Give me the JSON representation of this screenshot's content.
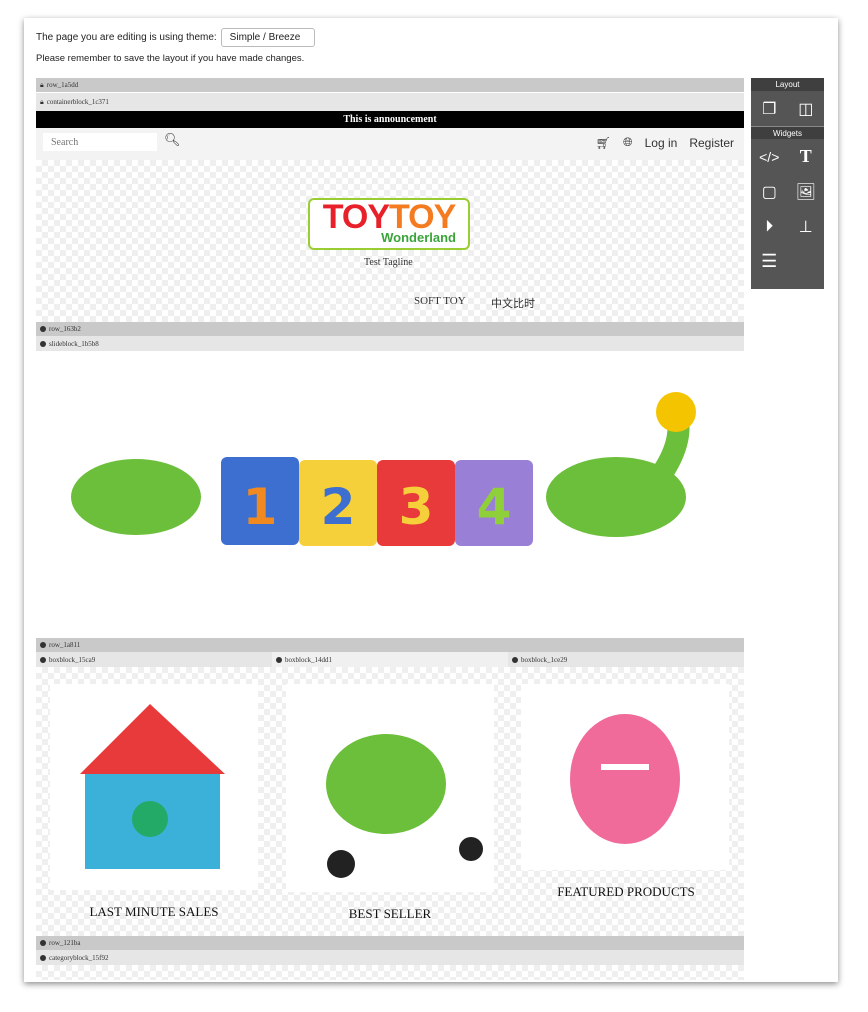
{
  "notice": {
    "theme_label": "The page you are editing is using theme:",
    "theme_value": "Simple / Breeze",
    "reminder": "Please remember to save the layout if you have made changes."
  },
  "blocks": {
    "row1": "row_1a5dd",
    "container": "containerblock_1c371",
    "row2": "row_163b2",
    "slide": "slideblock_1b5b8",
    "row3": "row_1a811",
    "box1": "boxblock_15ca9",
    "box2": "boxblock_14dd1",
    "box3": "boxblock_1ce29",
    "row4": "row_121ba",
    "category": "categoryblock_15f92"
  },
  "announcement": "This is announcement",
  "header": {
    "search_placeholder": "Search",
    "login": "Log in",
    "register": "Register"
  },
  "logo": {
    "text1": "TOY",
    "text2": "TOY",
    "sub": "Wonderland",
    "tagline": "Test Tagline"
  },
  "menu": [
    "SOFT TOY",
    "中文比时"
  ],
  "products": [
    "LAST MINUTE SALES",
    "BEST SELLER",
    "FEATURED PRODUCTS"
  ],
  "sidebar": {
    "layout": "Layout",
    "widgets": "Widgets"
  },
  "colors": {
    "toy1": "#e8202a",
    "toy2": "#f47b20",
    "logo_border": "#9acd32",
    "sidebar": "#555555"
  }
}
